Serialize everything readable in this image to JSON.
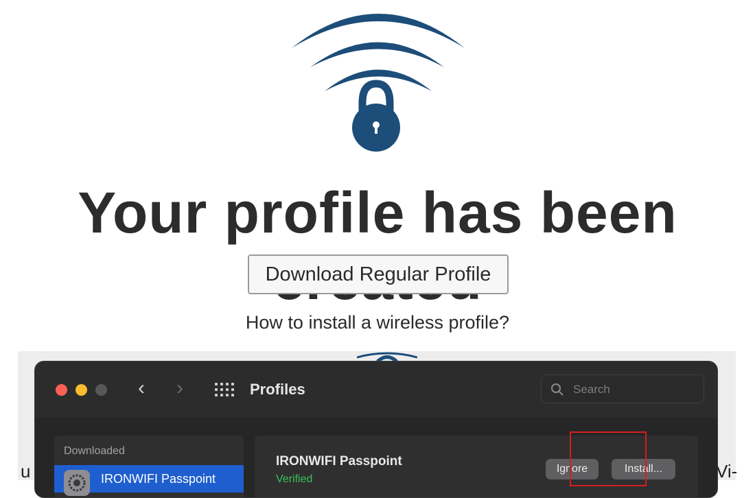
{
  "headline": "Your profile has been created",
  "download_button": "Download Regular Profile",
  "howto_link": "How to install a wireless profile?",
  "colors": {
    "logo_blue": "#1d4d79",
    "highlight_red": "#d41f1f",
    "verified_green": "#37c45a",
    "selected_blue": "#1f5ecf"
  },
  "screenshot": {
    "window_title": "Profiles",
    "search_placeholder": "Search",
    "sidebar": {
      "section": "Downloaded",
      "items": [
        {
          "label": "IRONWIFI Passpoint",
          "icon": "gear-icon",
          "selected": true
        }
      ]
    },
    "detail": {
      "profile_name": "IRONWIFI Passpoint",
      "status": "Verified",
      "ignore_button": "Ignore",
      "install_button": "Install..."
    },
    "side_text_left": "u",
    "side_text_right": "Vi-"
  }
}
